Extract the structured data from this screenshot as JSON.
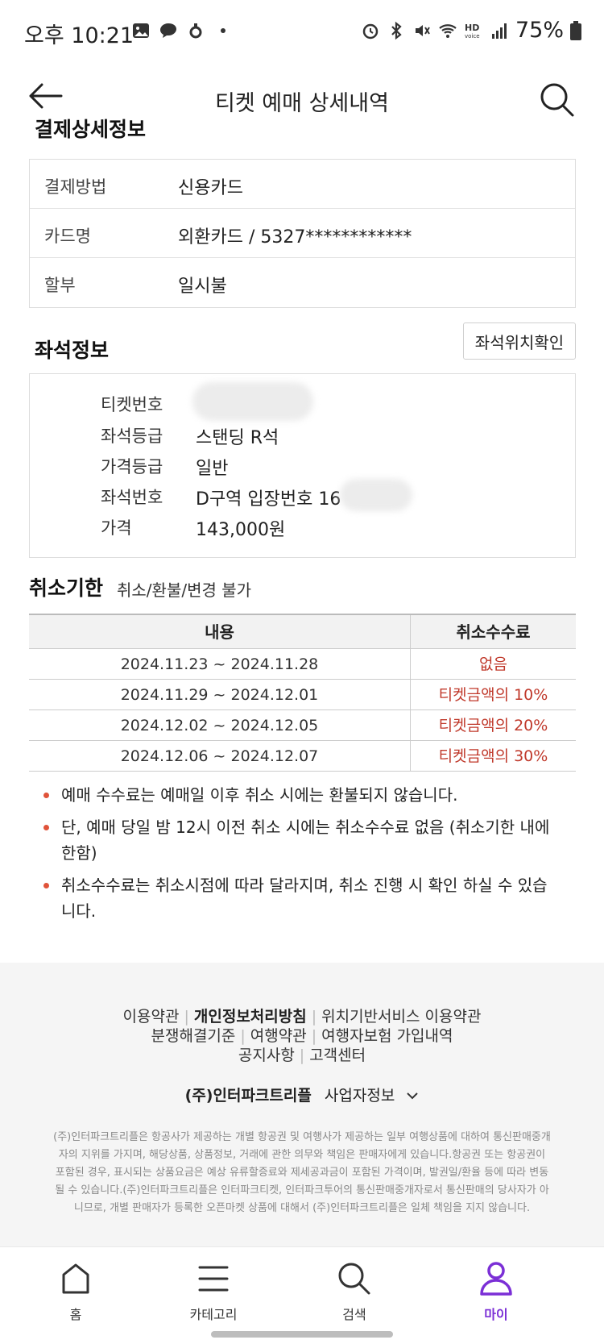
{
  "status_bar": {
    "time": "오후 10:21",
    "battery": "75%"
  },
  "header": {
    "title": "티켓 예매 상세내역"
  },
  "payment": {
    "section_title": "결제상세정보",
    "rows": [
      {
        "label": "결제방법",
        "value": "신용카드"
      },
      {
        "label": "카드명",
        "value": "외환카드 / 5327************"
      },
      {
        "label": "할부",
        "value": "일시불"
      }
    ]
  },
  "seat": {
    "section_title": "좌석정보",
    "position_button": "좌석위치확인",
    "rows": [
      {
        "label": "티켓번호",
        "value": ""
      },
      {
        "label": "좌석등급",
        "value": "스탠딩 R석"
      },
      {
        "label": "가격등급",
        "value": "일반"
      },
      {
        "label": "좌석번호",
        "value": "D구역 입장번호 16"
      },
      {
        "label": "가격",
        "value": "143,000원"
      }
    ]
  },
  "cancel": {
    "title": "취소기한",
    "subtitle": "취소/환불/변경 불가",
    "table": {
      "headers": [
        "내용",
        "취소수수료"
      ],
      "rows": [
        [
          "2024.11.23 ~ 2024.11.28",
          "없음"
        ],
        [
          "2024.11.29 ~ 2024.12.01",
          "티켓금액의 10%"
        ],
        [
          "2024.12.02 ~ 2024.12.05",
          "티켓금액의 20%"
        ],
        [
          "2024.12.06 ~ 2024.12.07",
          "티켓금액의 30%"
        ]
      ]
    },
    "notes": [
      "예매 수수료는 예매일 이후 취소 시에는 환불되지 않습니다.",
      "단, 예매 당일 밤 12시 이전 취소 시에는 취소수수료 없음 (취소기한 내에 한함)",
      "취소수수료는 취소시점에 따라 달라지며, 취소 진행 시 확인 하실 수 있습니다."
    ]
  },
  "footer": {
    "links_row1": [
      "이용약관",
      "개인정보처리방침",
      "위치기반서비스 이용약관"
    ],
    "links_row2": [
      "분쟁해결기준",
      "여행약관",
      "여행자보험 가입내역"
    ],
    "links_row3": [
      "공지사항",
      "고객센터"
    ],
    "company": "(주)인터파크트리플",
    "business_info": "사업자정보",
    "disclaimer": "(주)인터파크트리플은 항공사가 제공하는 개별 항공권 및 여행사가 제공하는 일부 여행상품에 대하여 통신판매중개자의 지위를 가지며, 해당상품, 상품정보, 거래에 관한 의무와 책임은 판매자에게 있습니다.항공권 또는 항공권이 포함된 경우, 표시되는 상품요금은 예상 유류할증료와 제세공과금이 포함된 가격이며, 발권일/환율 등에 따라 변동될 수 있습니다.(주)인터파크트리플은 인터파크티켓, 인터파크투어의 통신판매중개자로서 통신판매의 당사자가 아니므로, 개별 판매자가 등록한 오픈마켓 상품에 대해서 (주)인터파크트리플은 일체 책임을 지지 않습니다."
  },
  "bottom_nav": {
    "items": [
      {
        "label": "홈",
        "icon": "home-icon"
      },
      {
        "label": "카테고리",
        "icon": "menu-icon"
      },
      {
        "label": "검색",
        "icon": "search-icon"
      },
      {
        "label": "마이",
        "icon": "user-icon"
      }
    ],
    "active_color": "#7b2fd6"
  },
  "colors": {
    "fee_red": "#c0392b",
    "bullet": "#e0533a"
  }
}
